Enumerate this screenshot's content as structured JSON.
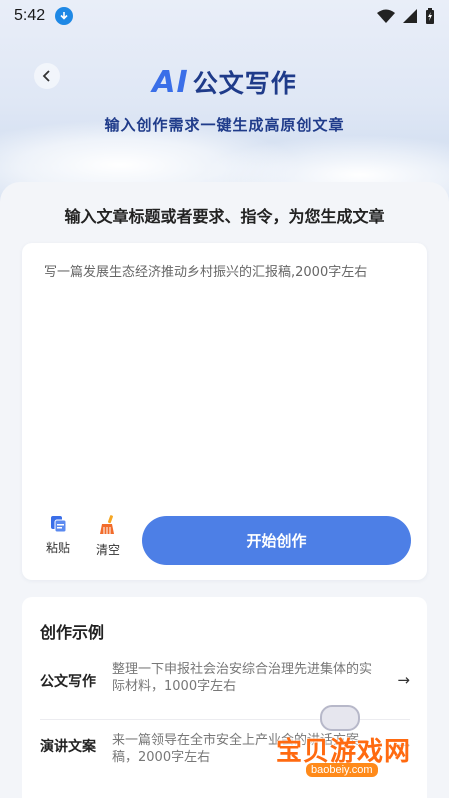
{
  "status_bar": {
    "time": "5:42"
  },
  "header": {
    "title_ai": "AI",
    "title_text": "公文写作",
    "subtitle": "输入创作需求一键生成高原创文章",
    "back_icon": "chevron-left-icon"
  },
  "prompt": {
    "heading": "输入文章标题或者要求、指令，为您生成文章",
    "input_value": "写一篇发展生态经济推动乡村振兴的汇报稿,2000字左右"
  },
  "tools": {
    "paste_label": "粘贴",
    "clear_label": "清空",
    "start_label": "开始创作"
  },
  "examples": {
    "title": "创作示例",
    "items": [
      {
        "label": "公文写作",
        "desc": "整理一下申报社会治安综合治理先进集体的实际材料，1000字左右",
        "arrow": "→"
      },
      {
        "label": "演讲文案",
        "desc": "来一篇领导在全市安全上产业会的讲话方案稿，2000字左右",
        "arrow": "→"
      }
    ]
  },
  "watermark": {
    "text": "宝贝游戏网",
    "url": "baobeiy.com"
  },
  "colors": {
    "accent": "#4d7fe6",
    "title_dark": "#1f3b8a",
    "watermark": "#ff6a10"
  }
}
